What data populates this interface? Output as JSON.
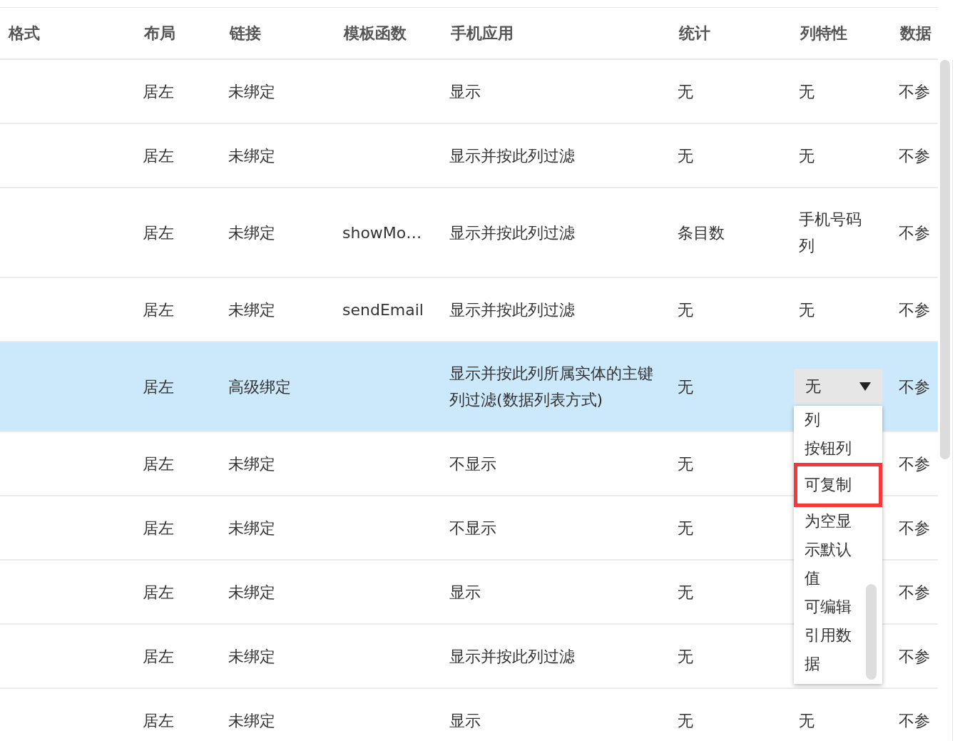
{
  "table": {
    "columns": [
      "格式",
      "布局",
      "链接",
      "模板函数",
      "手机应用",
      "统计",
      "列特性",
      "数据"
    ],
    "rows": [
      {
        "layout": "居左",
        "link": "未绑定",
        "mobile": "显示",
        "stats": "无",
        "column_feature": "无",
        "data": "不参",
        "selected": false
      },
      {
        "layout": "居左",
        "link": "未绑定",
        "mobile": "显示并按此列过滤",
        "stats": "无",
        "column_feature": "无",
        "data": "不参",
        "selected": false
      },
      {
        "layout": "居左",
        "link": "未绑定",
        "template": "showMo…",
        "mobile": "显示并按此列过滤",
        "stats": "条目数",
        "column_feature": "手机号码列",
        "data": "不参",
        "selected": false
      },
      {
        "layout": "居左",
        "link": "未绑定",
        "template": "sendEmail",
        "mobile": "显示并按此列过滤",
        "stats": "无",
        "column_feature": "无",
        "data": "不参",
        "selected": false
      },
      {
        "layout": "居左",
        "link": "高级绑定",
        "mobile": "显示并按此列所属实体的主键列过滤(数据列表方式)",
        "stats": "无",
        "column_feature_select": {
          "value": "无",
          "options": [
            {
              "label": "列",
              "highlighted": false
            },
            {
              "label": "按钮列",
              "highlighted": false
            },
            {
              "label": "可复制",
              "highlighted": true
            },
            {
              "label": "为空显示默认值",
              "highlighted": false
            },
            {
              "label": "可编辑",
              "highlighted": false
            },
            {
              "label": "引用数据",
              "highlighted": false
            }
          ]
        },
        "data": "不参",
        "selected": true
      },
      {
        "layout": "居左",
        "link": "未绑定",
        "mobile": "不显示",
        "stats": "无",
        "data": "不参",
        "selected": false
      },
      {
        "layout": "居左",
        "link": "未绑定",
        "mobile": "不显示",
        "stats": "无",
        "data": "不参",
        "selected": false
      },
      {
        "layout": "居左",
        "link": "未绑定",
        "mobile": "显示",
        "stats": "无",
        "data": "不参",
        "selected": false
      },
      {
        "layout": "居左",
        "link": "未绑定",
        "mobile": "显示并按此列过滤",
        "stats": "无",
        "data": "不参",
        "selected": false
      },
      {
        "layout": "居左",
        "link": "未绑定",
        "mobile": "显示",
        "stats": "无",
        "column_feature": "无",
        "data": "不参",
        "selected": false
      }
    ]
  }
}
